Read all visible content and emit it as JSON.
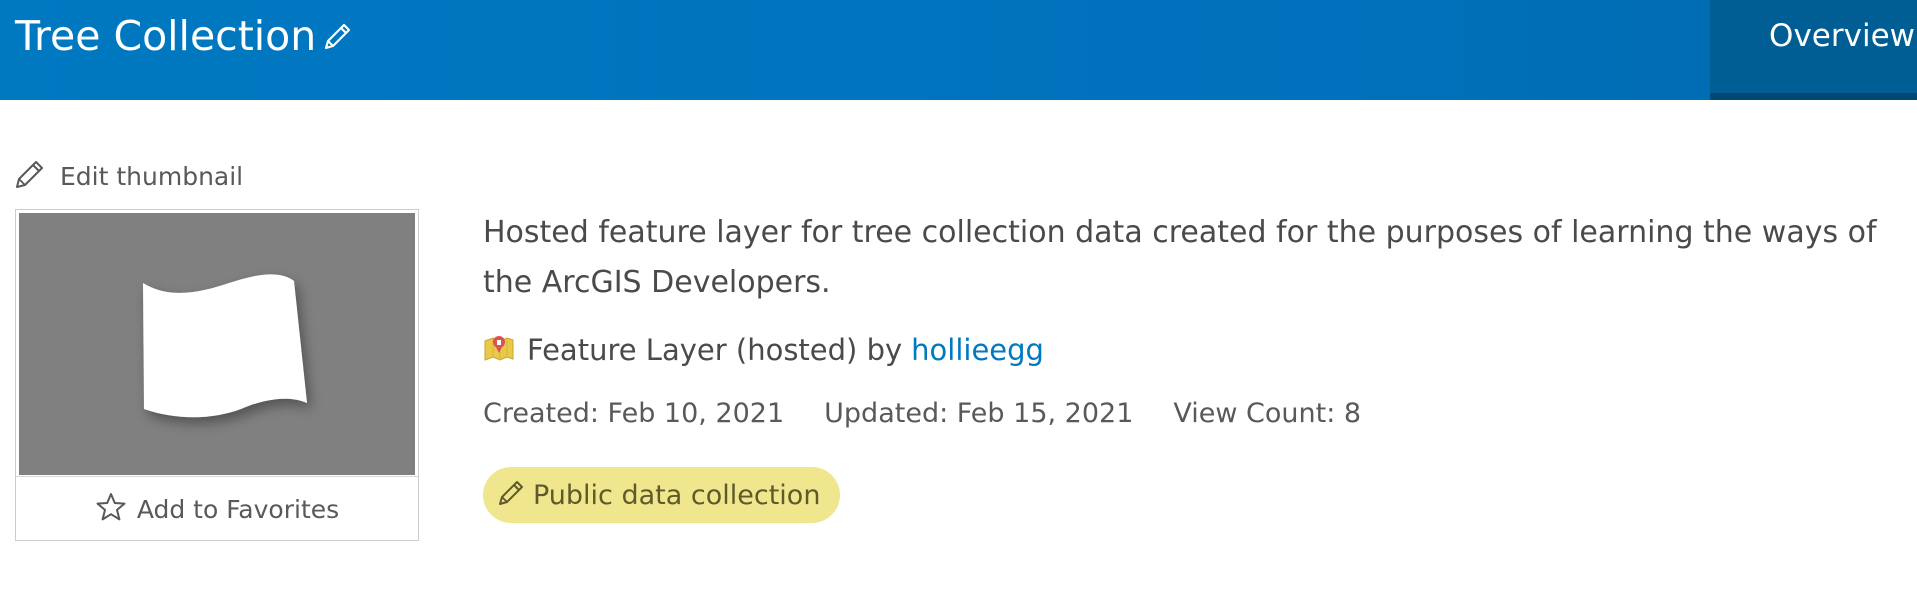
{
  "header": {
    "title": "Tree Collection",
    "tab_overview": "Overview"
  },
  "thumbnail": {
    "edit_label": "Edit thumbnail",
    "favorites_label": "Add to Favorites"
  },
  "item": {
    "description": "Hosted feature layer for tree collection data created for the purposes of learning the ways of the ArcGIS Developers.",
    "type_text": "Feature Layer (hosted) by",
    "owner": "hollieegg",
    "created": "Created: Feb 10, 2021",
    "updated": "Updated: Feb 15, 2021",
    "view_count": "View Count: 8",
    "badge": "Public data collection"
  },
  "colors": {
    "header_blue": "#0079c1",
    "tab_active": "#005e95",
    "link_blue": "#0079c1",
    "badge_bg": "#f0e68e",
    "thumb_bg": "#808080"
  },
  "icons": [
    "pencil-icon",
    "star-icon",
    "feature-layer-icon"
  ]
}
